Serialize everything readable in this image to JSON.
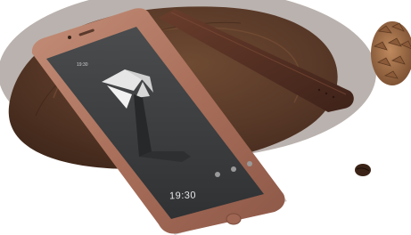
{
  "lock_screen": {
    "clock_text": "19:30",
    "status_time": "19:30"
  },
  "colors": {
    "background": "#ffffff",
    "table_wood": "#5a3a26",
    "phone_body": "#b07a66",
    "screen": "#3c3e40",
    "leather_strap": "#5b3326",
    "pinecone": "#a3724c",
    "coffee_bean": "#3b2417"
  }
}
